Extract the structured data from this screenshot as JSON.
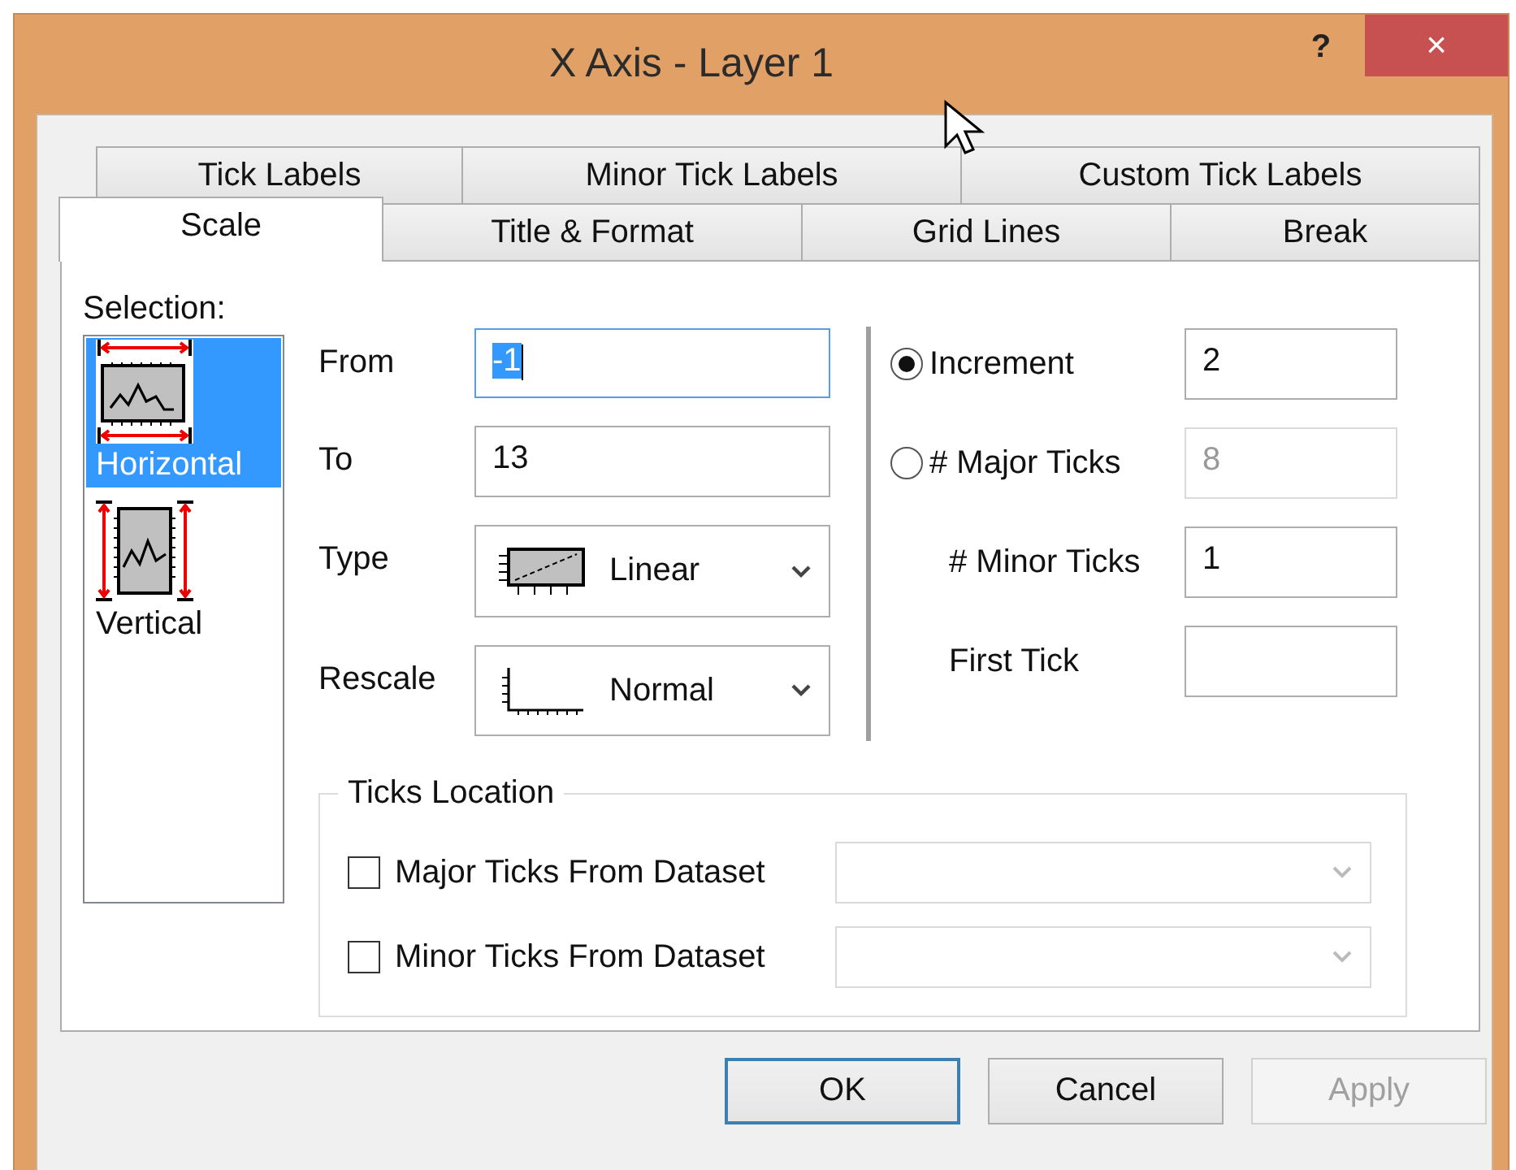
{
  "window": {
    "title": "X Axis - Layer 1",
    "help": "?",
    "close": "×"
  },
  "tab_rows": [
    [
      {
        "label": "Tick Labels",
        "selected": false
      },
      {
        "label": "Minor Tick Labels",
        "selected": false
      },
      {
        "label": "Custom Tick Labels",
        "selected": false
      }
    ],
    [
      {
        "label": "Scale",
        "selected": true
      },
      {
        "label": "Title & Format",
        "selected": false
      },
      {
        "label": "Grid Lines",
        "selected": false
      },
      {
        "label": "Break",
        "selected": false
      }
    ]
  ],
  "selection": {
    "label": "Selection:",
    "items": [
      {
        "label": "Horizontal",
        "kind": "horizontal",
        "selected": true
      },
      {
        "label": "Vertical",
        "kind": "vertical",
        "selected": false
      }
    ]
  },
  "range_fields": [
    {
      "label": "From",
      "value": "-1",
      "focused": true
    },
    {
      "label": "To",
      "value": "13",
      "focused": false
    }
  ],
  "dropdowns": [
    {
      "label": "Type",
      "value": "Linear",
      "kind": "linear"
    },
    {
      "label": "Rescale",
      "value": "Normal",
      "kind": "normal"
    }
  ],
  "tick_options": [
    {
      "kind": "radio",
      "label": "Increment",
      "selected": true,
      "value": "2",
      "disabled": false
    },
    {
      "kind": "radio",
      "label": "# Major Ticks",
      "selected": false,
      "value": "8",
      "disabled": true
    },
    {
      "kind": "field",
      "label": "# Minor Ticks",
      "value": "1",
      "disabled": false
    },
    {
      "kind": "field",
      "label": "First Tick",
      "disabled": false
    }
  ],
  "ticks_location": {
    "title": "Ticks Location",
    "rows": [
      {
        "label": "Major Ticks From Dataset",
        "checked": false
      },
      {
        "label": "Minor Ticks From Dataset",
        "checked": false
      }
    ]
  },
  "buttons": [
    {
      "label": "OK",
      "default": true,
      "disabled": false
    },
    {
      "label": "Cancel",
      "default": false,
      "disabled": false
    },
    {
      "label": "Apply",
      "default": false,
      "disabled": true
    }
  ]
}
